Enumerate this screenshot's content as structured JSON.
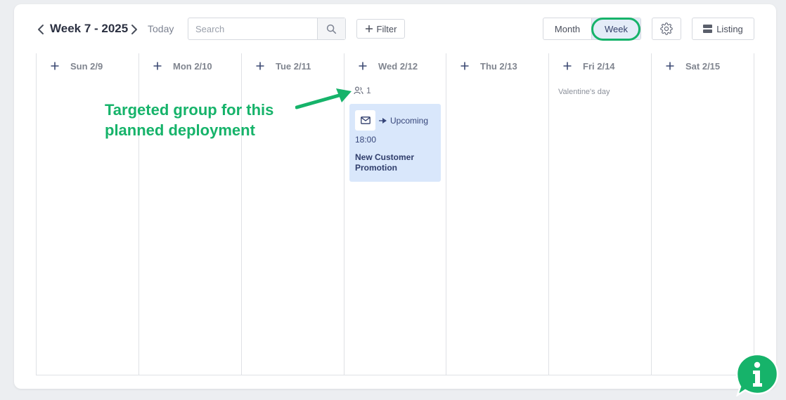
{
  "toolbar": {
    "week_label": "Week 7 - 2025",
    "today_label": "Today",
    "search_placeholder": "Search",
    "filter_label": "Filter",
    "view_month_label": "Month",
    "view_week_label": "Week",
    "active_view": "Week",
    "listing_label": "Listing"
  },
  "days": [
    {
      "label": "Sun 2/9",
      "holiday": ""
    },
    {
      "label": "Mon 2/10",
      "holiday": ""
    },
    {
      "label": "Tue 2/11",
      "holiday": ""
    },
    {
      "label": "Wed 2/12",
      "holiday": ""
    },
    {
      "label": "Thu 2/13",
      "holiday": ""
    },
    {
      "label": "Fri 2/14",
      "holiday": "Valentine's day"
    },
    {
      "label": "Sat 2/15",
      "holiday": ""
    }
  ],
  "event": {
    "day": "Wed 2/12",
    "group_count": "1",
    "status": "Upcoming",
    "time": "18:00",
    "title": "New Customer Promotion",
    "icon": "envelope-icon"
  },
  "annotation": {
    "line1": "Targeted group for this",
    "line2": "planned deployment"
  },
  "colors": {
    "accent": "#16b36a",
    "event_bg": "#d9e7fb",
    "active_view_bg": "#e4ecf8",
    "text_dark": "#2b3041"
  },
  "icons": {
    "prev": "chevron-left-icon",
    "next": "chevron-right-icon",
    "search": "search-icon",
    "filter": "plus-icon",
    "settings": "gear-icon",
    "listing": "list-icon",
    "group": "users-icon",
    "status": "send-icon",
    "info": "info-icon"
  }
}
